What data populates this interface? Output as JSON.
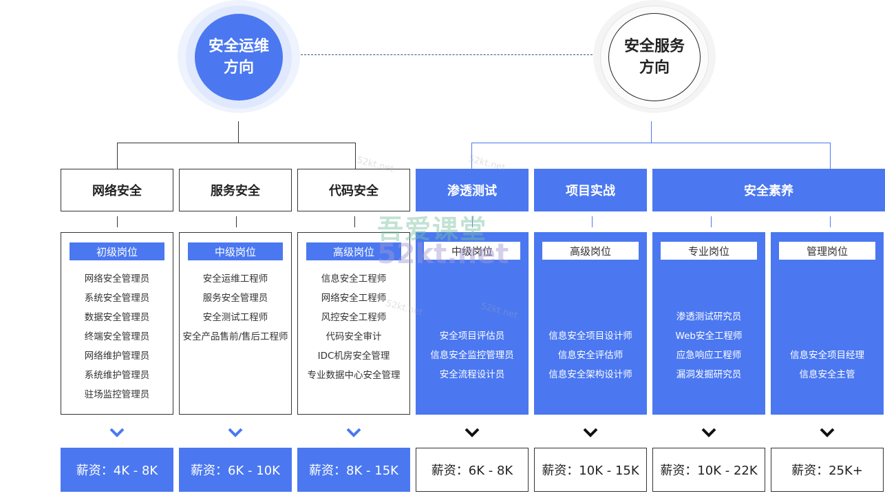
{
  "left_circle": {
    "line1": "安全运维",
    "line2": "方向"
  },
  "right_circle": {
    "line1": "安全服务",
    "line2": "方向"
  },
  "columns": [
    {
      "header": "网络安全",
      "level": "初级岗位",
      "jobs": [
        "网络安全管理员",
        "系统安全管理员",
        "数据安全管理员",
        "终端安全管理员",
        "网络维护管理员",
        "系统维护管理员",
        "驻场监控管理员"
      ],
      "salary": "薪资：4K - 8K"
    },
    {
      "header": "服务安全",
      "level": "中级岗位",
      "jobs": [
        "安全运维工程师",
        "服务安全管理员",
        "安全测试工程师",
        "安全产品售前/售后工程师"
      ],
      "salary": "薪资：6K - 10K"
    },
    {
      "header": "代码安全",
      "level": "高级岗位",
      "jobs": [
        "信息安全工程师",
        "网络安全工程师",
        "风控安全工程师",
        "代码安全审计",
        "IDC机房安全管理",
        "专业数据中心安全管理"
      ],
      "salary": "薪资：8K - 15K"
    },
    {
      "header": "渗透测试",
      "level": "中级岗位",
      "jobs": [
        "安全项目评估员",
        "信息安全监控管理员",
        "安全流程设计员"
      ],
      "salary": "薪资：6K - 8K"
    },
    {
      "header": "项目实战",
      "level": "高级岗位",
      "jobs": [
        "信息安全项目设计师",
        "信息安全评估师",
        "信息安全架构设计师"
      ],
      "salary": "薪资：10K - 15K"
    },
    {
      "header": "安全素养",
      "level": "专业岗位",
      "jobs": [
        "渗透测试研究员",
        "Web安全工程师",
        "应急响应工程师",
        "漏洞发掘研究员"
      ],
      "salary": "薪资：10K - 22K"
    },
    {
      "header": "",
      "level": "管理岗位",
      "jobs": [
        "信息安全项目经理",
        "信息安全主管"
      ],
      "salary": "薪资：25K+"
    }
  ],
  "watermark": {
    "big1": "吾爱课堂",
    "big2": "52kt.net",
    "small": "52kt.net"
  },
  "colors": {
    "accent": "#4b78f0",
    "dark": "#222222"
  }
}
